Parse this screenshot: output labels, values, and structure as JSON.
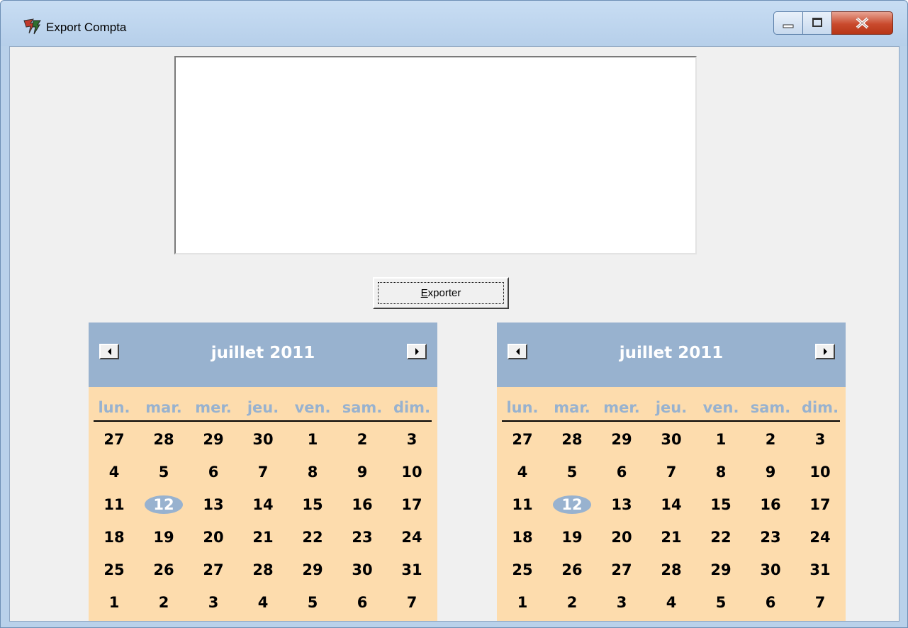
{
  "window": {
    "title": "Export Compta"
  },
  "output": {
    "value": ""
  },
  "export_button": {
    "label": "Exporter"
  },
  "colors": {
    "calendar_header": "#98b2cf",
    "calendar_body": "#fddcad",
    "today_highlight": "#98b2cf"
  },
  "calendars": [
    {
      "month_label": "juillet 2011",
      "weekdays": [
        "lun.",
        "mar.",
        "mer.",
        "jeu.",
        "ven.",
        "sam.",
        "dim."
      ],
      "weeks": [
        [
          "27",
          "28",
          "29",
          "30",
          "1",
          "2",
          "3"
        ],
        [
          "4",
          "5",
          "6",
          "7",
          "8",
          "9",
          "10"
        ],
        [
          "11",
          "12",
          "13",
          "14",
          "15",
          "16",
          "17"
        ],
        [
          "18",
          "19",
          "20",
          "21",
          "22",
          "23",
          "24"
        ],
        [
          "25",
          "26",
          "27",
          "28",
          "29",
          "30",
          "31"
        ],
        [
          "1",
          "2",
          "3",
          "4",
          "5",
          "6",
          "7"
        ]
      ],
      "selected_day": "12"
    },
    {
      "month_label": "juillet 2011",
      "weekdays": [
        "lun.",
        "mar.",
        "mer.",
        "jeu.",
        "ven.",
        "sam.",
        "dim."
      ],
      "weeks": [
        [
          "27",
          "28",
          "29",
          "30",
          "1",
          "2",
          "3"
        ],
        [
          "4",
          "5",
          "6",
          "7",
          "8",
          "9",
          "10"
        ],
        [
          "11",
          "12",
          "13",
          "14",
          "15",
          "16",
          "17"
        ],
        [
          "18",
          "19",
          "20",
          "21",
          "22",
          "23",
          "24"
        ],
        [
          "25",
          "26",
          "27",
          "28",
          "29",
          "30",
          "31"
        ],
        [
          "1",
          "2",
          "3",
          "4",
          "5",
          "6",
          "7"
        ]
      ],
      "selected_day": "12"
    }
  ]
}
